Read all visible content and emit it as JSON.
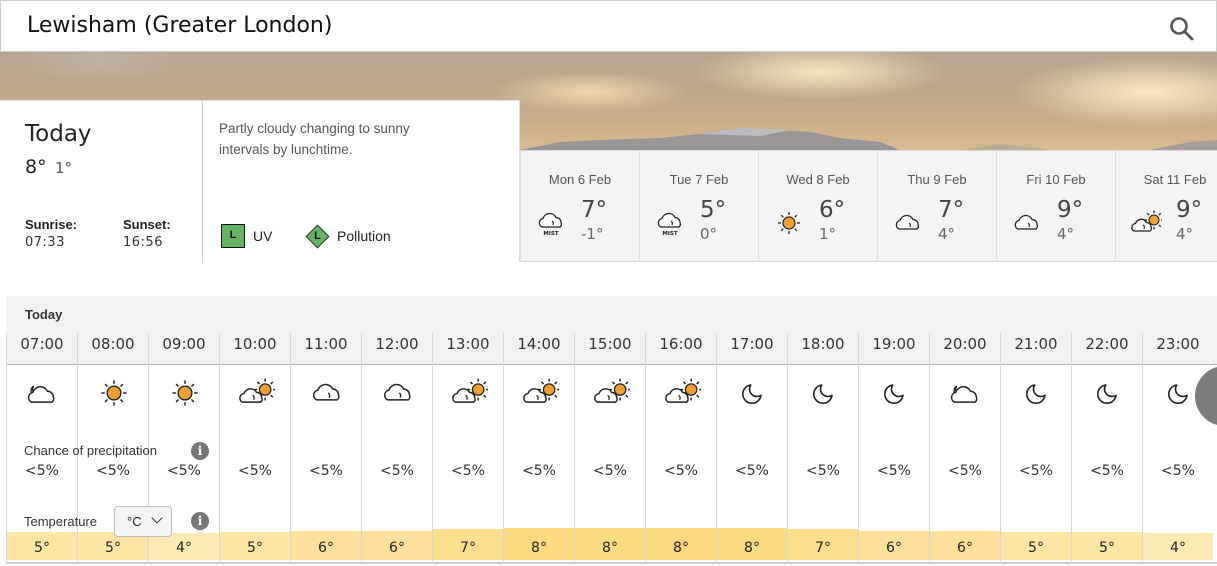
{
  "header": {
    "location": "Lewisham (Greater London)",
    "search_icon": "search-icon"
  },
  "today": {
    "label": "Today",
    "high": "8°",
    "low": "1°",
    "sunrise_label": "Sunrise:",
    "sunrise": "07:33",
    "sunset_label": "Sunset:",
    "sunset": "16:56",
    "description": "Partly cloudy changing to sunny intervals by lunchtime.",
    "uv": {
      "level": "L",
      "label": "UV",
      "color": "#67b365"
    },
    "pollution": {
      "level": "L",
      "label": "Pollution",
      "color": "#67b365"
    }
  },
  "days": [
    {
      "date": "Mon 6 Feb",
      "icon": "mist",
      "high": "7°",
      "low": "-1°"
    },
    {
      "date": "Tue 7 Feb",
      "icon": "mist",
      "high": "5°",
      "low": "0°"
    },
    {
      "date": "Wed 8 Feb",
      "icon": "sunny",
      "high": "6°",
      "low": "1°"
    },
    {
      "date": "Thu 9 Feb",
      "icon": "cloudy",
      "high": "7°",
      "low": "4°"
    },
    {
      "date": "Fri 10 Feb",
      "icon": "cloudy",
      "high": "9°",
      "low": "4°"
    },
    {
      "date": "Sat 11 Feb",
      "icon": "sunny-intervals",
      "high": "9°",
      "low": "4°"
    }
  ],
  "hourly": {
    "day_label": "Today",
    "precip_label": "Chance of precipitation",
    "temp_label": "Temperature",
    "unit": "°C",
    "info_glyph": "i",
    "hours": [
      {
        "time": "07:00",
        "icon": "partly-cloudy-night",
        "precip": "<5%",
        "temp": "5°",
        "t": 5
      },
      {
        "time": "08:00",
        "icon": "sunny",
        "precip": "<5%",
        "temp": "5°",
        "t": 5
      },
      {
        "time": "09:00",
        "icon": "sunny",
        "precip": "<5%",
        "temp": "4°",
        "t": 4
      },
      {
        "time": "10:00",
        "icon": "sunny-intervals",
        "precip": "<5%",
        "temp": "5°",
        "t": 5
      },
      {
        "time": "11:00",
        "icon": "cloudy",
        "precip": "<5%",
        "temp": "6°",
        "t": 6
      },
      {
        "time": "12:00",
        "icon": "cloudy",
        "precip": "<5%",
        "temp": "6°",
        "t": 6
      },
      {
        "time": "13:00",
        "icon": "sunny-intervals",
        "precip": "<5%",
        "temp": "7°",
        "t": 7
      },
      {
        "time": "14:00",
        "icon": "sunny-intervals",
        "precip": "<5%",
        "temp": "8°",
        "t": 8
      },
      {
        "time": "15:00",
        "icon": "sunny-intervals",
        "precip": "<5%",
        "temp": "8°",
        "t": 8
      },
      {
        "time": "16:00",
        "icon": "sunny-intervals",
        "precip": "<5%",
        "temp": "8°",
        "t": 8
      },
      {
        "time": "17:00",
        "icon": "clear-night",
        "precip": "<5%",
        "temp": "8°",
        "t": 8
      },
      {
        "time": "18:00",
        "icon": "clear-night",
        "precip": "<5%",
        "temp": "7°",
        "t": 7
      },
      {
        "time": "19:00",
        "icon": "clear-night",
        "precip": "<5%",
        "temp": "6°",
        "t": 6
      },
      {
        "time": "20:00",
        "icon": "partly-cloudy-night",
        "precip": "<5%",
        "temp": "6°",
        "t": 6
      },
      {
        "time": "21:00",
        "icon": "clear-night",
        "precip": "<5%",
        "temp": "5°",
        "t": 5
      },
      {
        "time": "22:00",
        "icon": "clear-night",
        "precip": "<5%",
        "temp": "5°",
        "t": 5
      },
      {
        "time": "23:00",
        "icon": "clear-night",
        "precip": "<5%",
        "temp": "4°",
        "t": 4
      }
    ]
  },
  "colors": {
    "sun": "#f0a030",
    "temp_4": "#fdebb3",
    "temp_5": "#fde6a3",
    "temp_6": "#fde19a",
    "temp_7": "#fcdf8e",
    "temp_8": "#fbdb80",
    "uv_low": "#67b365"
  }
}
